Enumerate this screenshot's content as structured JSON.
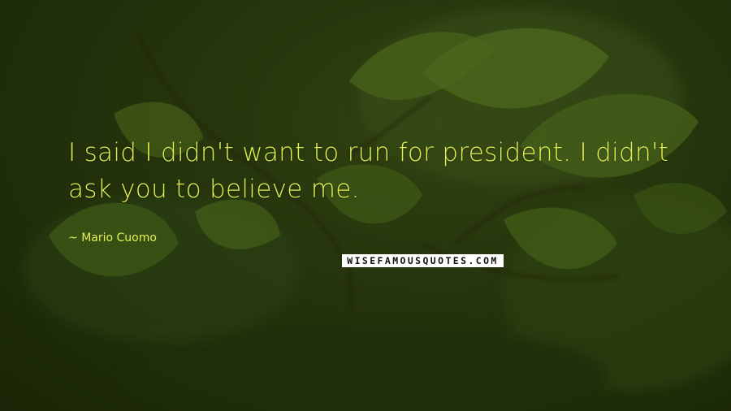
{
  "image": {
    "description_scene": "green leaves on branches, dark blurred background",
    "colors": {
      "text": "#e3ef52",
      "leaf": "#5a7a22",
      "background": "#2a3c10"
    }
  },
  "quote": {
    "text": "I said I didn't want to run for president. I didn't ask you to believe me.",
    "author": "Mario Cuomo"
  },
  "watermark": {
    "text": "WISEFAMOUSQUOTES.COM"
  }
}
